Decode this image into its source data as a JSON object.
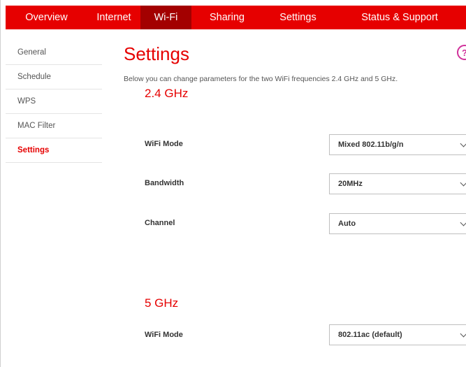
{
  "nav": {
    "items": [
      {
        "label": "Overview"
      },
      {
        "label": "Internet"
      },
      {
        "label": "Wi-Fi"
      },
      {
        "label": "Sharing"
      },
      {
        "label": "Settings"
      },
      {
        "label": "Status & Support"
      }
    ],
    "active": "Wi-Fi"
  },
  "sidebar": {
    "items": [
      {
        "label": "General"
      },
      {
        "label": "Schedule"
      },
      {
        "label": "WPS"
      },
      {
        "label": "MAC Filter"
      },
      {
        "label": "Settings"
      }
    ],
    "active": "Settings"
  },
  "page": {
    "title": "Settings",
    "description": "Below you can change parameters for the two WiFi frequencies 2.4 GHz and 5 GHz.",
    "help_icon": "help-icon"
  },
  "band24": {
    "title": "2.4 GHz",
    "wifi_mode": {
      "label": "WiFi Mode",
      "value": "Mixed 802.11b/g/n"
    },
    "bandwidth": {
      "label": "Bandwidth",
      "value": "20MHz"
    },
    "channel": {
      "label": "Channel",
      "value": "Auto"
    }
  },
  "band5": {
    "title": "5 GHz",
    "wifi_mode": {
      "label": "WiFi Mode",
      "value": "802.11ac (default)"
    }
  },
  "colors": {
    "brand": "#e60000",
    "nav_active": "#a30000",
    "help": "#d0309a"
  }
}
